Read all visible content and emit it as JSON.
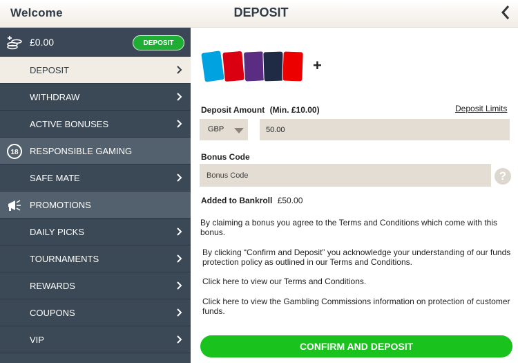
{
  "header": {
    "welcome": "Welcome",
    "title": "DEPOSIT",
    "back_icon": "chevron-left-icon"
  },
  "sidebar": {
    "balance": "£0.00",
    "deposit_button": "DEPOSIT",
    "items": [
      {
        "label": "DEPOSIT",
        "active": true
      },
      {
        "label": "WITHDRAW"
      },
      {
        "label": "ACTIVE BONUSES"
      },
      {
        "label": "RESPONSIBLE GAMING",
        "section": true,
        "icon": "age-18-icon"
      },
      {
        "label": "SAFE MATE"
      },
      {
        "label": "PROMOTIONS",
        "section": true,
        "icon": "megaphone-icon"
      },
      {
        "label": "DAILY PICKS"
      },
      {
        "label": "TOURNAMENTS"
      },
      {
        "label": "REWARDS"
      },
      {
        "label": "COUPONS"
      },
      {
        "label": "VIP"
      }
    ]
  },
  "main": {
    "bank_cards": [
      "#00a3e0",
      "#db0011",
      "#5a2d82",
      "#1f2a44",
      "#ec0000"
    ],
    "plus": "+",
    "deposit_amount_label": "Deposit Amount",
    "min_label": "(Min. £10.00)",
    "deposit_limits": "Deposit Limits",
    "currency": "GBP",
    "amount": "50.00",
    "bonus_code_label": "Bonus Code",
    "bonus_code_placeholder": "Bonus Code",
    "help": "?",
    "added_label": "Added to Bankroll",
    "added_value": "£50.00",
    "para1": "By claiming a bonus you agree to the  Terms and Conditions  which come with this bonus.",
    "para2": "By clicking “Confirm and Deposit” you acknowledge your understanding of our funds protection policy as outlined in our Terms and Conditions.",
    "para3": "Click here to view our Terms and Conditions.",
    "para4": "Click here  to view the Gambling Commissions information on protection of customer funds.",
    "confirm_button": "CONFIRM AND DEPOSIT"
  },
  "colors": {
    "sidebar_bg": "#3b4856",
    "section_bg": "#53616f",
    "active_bg": "#f1ece4",
    "field_bg": "#e3ddd3",
    "green": "#19c21d"
  }
}
